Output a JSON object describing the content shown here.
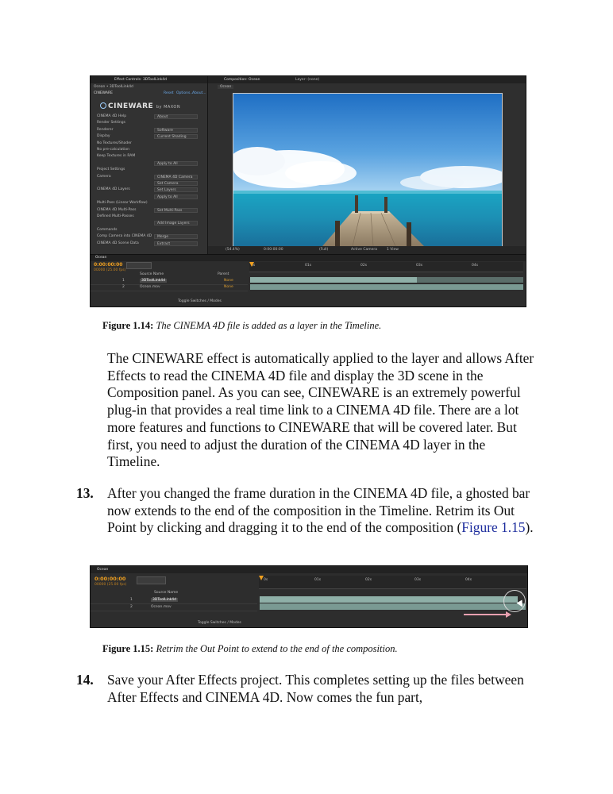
{
  "figure_1_14": {
    "screenshot": {
      "effect_controls_tab": "Effect Controls: 3DToolLink4d",
      "effect_controls_subtitle": "Ocean • 3DToolLink4d",
      "effect_name": "CINEWARE",
      "effect_links": [
        "Reset",
        "Options...",
        "About..."
      ],
      "logo_text": "CINEWARE",
      "logo_by": "by MAXON",
      "settings_rows": [
        {
          "label": "CINEMA 4D Help",
          "value": "About"
        },
        {
          "label": "Render Settings",
          "value": ""
        },
        {
          "label": "Renderer",
          "value": "Software"
        },
        {
          "label": "Display",
          "value": "Current Shading"
        },
        {
          "label": "No Textures/Shader",
          "value": ""
        },
        {
          "label": "No pre-calculation",
          "value": ""
        },
        {
          "label": "Keep Textures in RAM",
          "value": ""
        },
        {
          "label": "",
          "value": "Apply to All"
        },
        {
          "label": "Project Settings",
          "value": ""
        },
        {
          "label": "Camera",
          "value": "CINEMA 4D Camera"
        },
        {
          "label": "",
          "value": "Set Camera"
        },
        {
          "label": "CINEMA 4D Layers",
          "value": "Set Layers"
        },
        {
          "label": "",
          "value": "Apply to All"
        },
        {
          "label": "Multi-Pass (Linear Workflow)",
          "value": ""
        },
        {
          "label": "CINEMA 4D Multi-Pass",
          "value": "Set Multi-Pass"
        },
        {
          "label": "Defined Multi-Passes",
          "value": ""
        },
        {
          "label": "",
          "value": "Add Image Layers"
        },
        {
          "label": "Commands",
          "value": ""
        },
        {
          "label": "Comp Camera into CINEMA 4D",
          "value": "Merge"
        },
        {
          "label": "CINEMA 4D Scene Data",
          "value": "Extract"
        }
      ],
      "comp_tab": "Composition: Ocean",
      "comp_tab2": "Layer: (none)",
      "comp_subtab": "Ocean",
      "viewer_zoom": "(54.4%)",
      "viewer_time": "0:00:00:00",
      "viewer_resolution": "(Full)",
      "viewer_camera": "Active Camera",
      "viewer_view": "1 View",
      "timeline_tab": "Ocean",
      "current_time": "0:00:00:00",
      "fps_info": "00000 (25.00 fps)",
      "search_placeholder": "",
      "layer_header": "Source Name",
      "parent_header": "Parent",
      "layers": [
        {
          "num": "1",
          "name": "3DToolLink4d",
          "parent": "None"
        },
        {
          "num": "2",
          "name": "Ocean.mov",
          "parent": "None"
        }
      ],
      "ruler_labels": [
        "0s",
        "01s",
        "02s",
        "03s",
        "04s"
      ],
      "toggle_label": "Toggle Switches / Modes"
    },
    "caption_label": "Figure 1.14:",
    "caption_text": "The CINEMA 4D file is added as a layer in the Timeline."
  },
  "paragraph_1": "The CINEWARE effect is automatically applied to the layer and allows After Effects to read the CINEMA 4D file and display the 3D scene in the Composition panel. As you can see, CINEWARE is an extremely powerful plug-in that provides a real time link to a CINEMA 4D file. There are a lot more features and functions to CINEWARE that will be covered later. But first, you need to adjust the duration of the CINEMA 4D layer in the Timeline.",
  "step_13": {
    "number": "13.",
    "text_before": "After you changed the frame duration in the CINEMA 4D file, a ghosted bar now extends to the end of the composition in the Timeline. Retrim its Out Point by clicking and dragging it to the end of the composition (",
    "link": "Figure 1.15",
    "text_after": ")."
  },
  "figure_1_15": {
    "screenshot": {
      "timeline_tab": "Ocean",
      "current_time": "0:00:00:00",
      "fps_info": "00000 (25.00 fps)",
      "layer_header": "Source Name",
      "layers": [
        {
          "num": "1",
          "name": "3DToolLink4d"
        },
        {
          "num": "2",
          "name": "Ocean.mov"
        }
      ],
      "ruler_labels": [
        "0s",
        "01s",
        "02s",
        "03s",
        "04s"
      ],
      "toggle_label": "Toggle Switches / Modes"
    },
    "caption_label": "Figure 1.15:",
    "caption_text": "Retrim the Out Point to extend to the end of the composition."
  },
  "step_14": {
    "number": "14.",
    "text": "Save your After Effects project. This completes setting up the files between After Effects and CINEMA 4D. Now comes the fun part,"
  }
}
